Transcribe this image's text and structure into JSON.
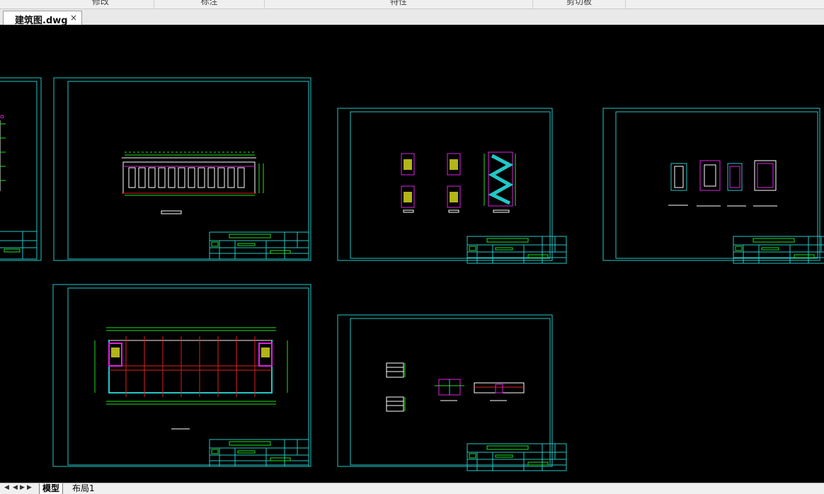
{
  "ribbon": {
    "groups": [
      "修改",
      "标注",
      "特性",
      "剪切板"
    ]
  },
  "document_tab": {
    "title": "建筑图.dwg",
    "close_glyph": "×"
  },
  "layout_tabs": {
    "model": "模型",
    "layout1": "布局1"
  },
  "colors": {
    "frame": "#22c7c7",
    "green": "#20e020",
    "magenta": "#e020e0",
    "red": "#e02020",
    "yellow": "#e0e020",
    "white": "#ffffff",
    "background": "#000000"
  }
}
